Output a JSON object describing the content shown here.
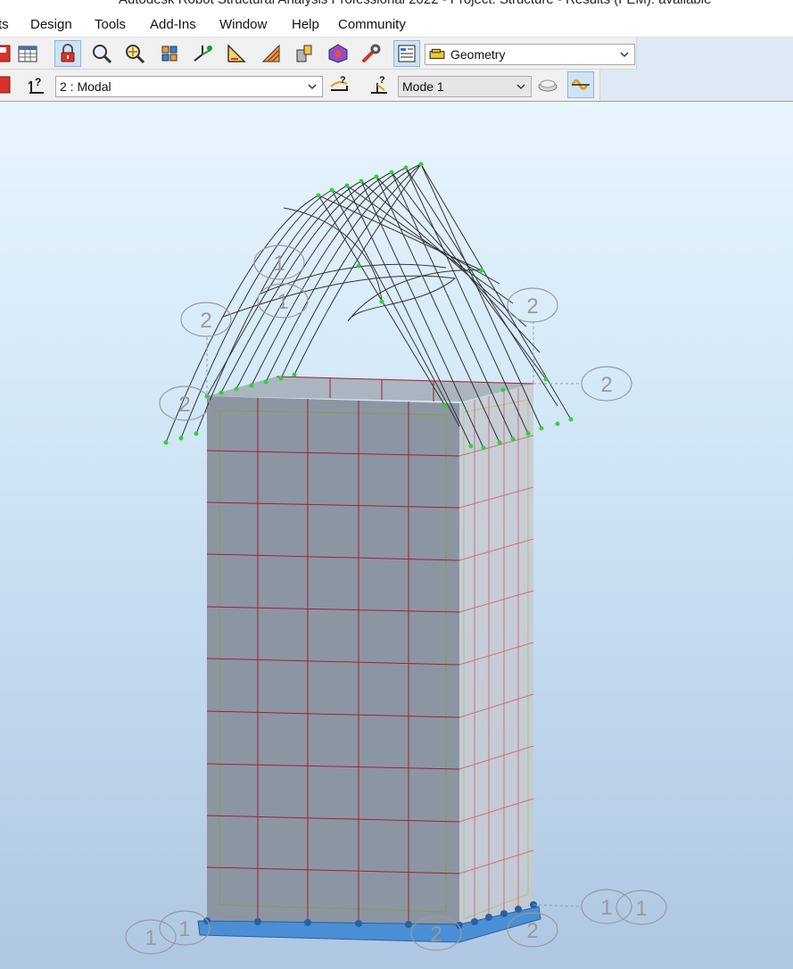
{
  "window": {
    "title": "Autodesk Robot Structural Analysis Professional 2022 - Project: Structure - Results (FEM): available"
  },
  "menu": {
    "items": [
      {
        "label": "ts"
      },
      {
        "label": "Design"
      },
      {
        "label": "Tools"
      },
      {
        "label": "Add-Ins"
      },
      {
        "label": "Window"
      },
      {
        "label": "Help"
      },
      {
        "label": "Community"
      }
    ]
  },
  "toolbar": {
    "view_dropdown": {
      "value": "Geometry",
      "icon": "layout-icon"
    },
    "icons": [
      "table-icon",
      "lock-icon",
      "zoom-icon",
      "pan-icon",
      "view-3d-icon",
      "axis-icon",
      "measure-icon",
      "hatch-icon",
      "section-icon",
      "model-icon",
      "wrench-icon",
      "layout-selector-icon"
    ]
  },
  "toolbar2": {
    "case_dropdown": {
      "value": "2 : Modal"
    },
    "mode_dropdown": {
      "value": "Mode  1"
    },
    "icons": [
      "load-case-icon",
      "deformation-icon",
      "mode-shape-icon",
      "section-view-icon",
      "animation-icon"
    ]
  },
  "viewport": {
    "labels": {
      "axis_1": "1",
      "axis_2": "2"
    },
    "colors": {
      "background_top": "#e7f5fe",
      "background_bottom": "#aec7e2",
      "wall_fill": "#8b96a2",
      "mesh_line": "#b01830",
      "deformed_line": "#2a2a2a",
      "node": "#2bd62b",
      "support": "#4a8fd6"
    }
  }
}
